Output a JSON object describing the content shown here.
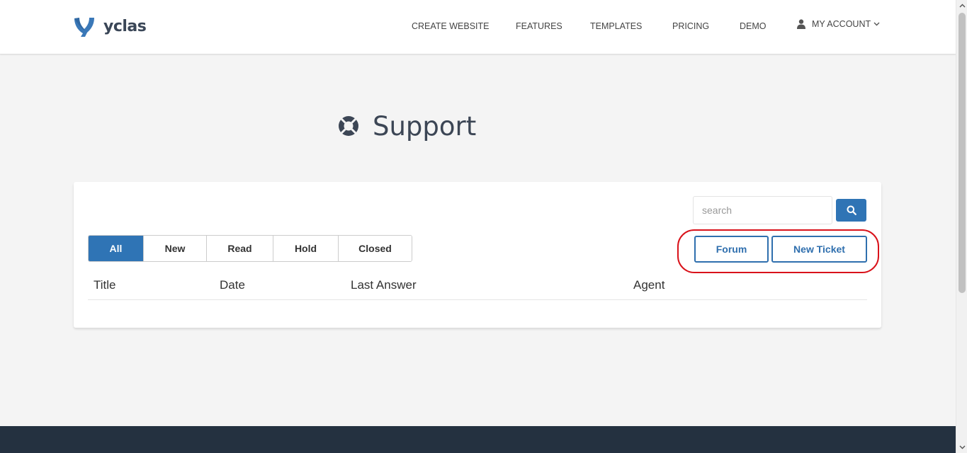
{
  "brand": {
    "name": "yclas"
  },
  "nav": {
    "items": [
      {
        "label": "CREATE WEBSITE"
      },
      {
        "label": "FEATURES"
      },
      {
        "label": "TEMPLATES"
      },
      {
        "label": "PRICING"
      },
      {
        "label": "DEMO"
      }
    ],
    "account_label": "MY ACCOUNT"
  },
  "page": {
    "title": "Support"
  },
  "search": {
    "placeholder": "search"
  },
  "filters": [
    {
      "label": "All",
      "active": true
    },
    {
      "label": "New",
      "active": false
    },
    {
      "label": "Read",
      "active": false
    },
    {
      "label": "Hold",
      "active": false
    },
    {
      "label": "Closed",
      "active": false
    }
  ],
  "actions": {
    "forum_label": "Forum",
    "new_ticket_label": "New Ticket"
  },
  "table": {
    "columns": [
      "Title",
      "Date",
      "Last Answer",
      "Agent"
    ]
  },
  "colors": {
    "primary": "#2f74b5",
    "footer": "#243140",
    "highlight": "#d9121a",
    "background": "#f4f4f4"
  },
  "icons": {
    "logo": "yclas-logo-icon",
    "user": "user-icon",
    "chevron": "chevron-down-icon",
    "support": "lifebuoy-icon",
    "search": "search-icon"
  }
}
